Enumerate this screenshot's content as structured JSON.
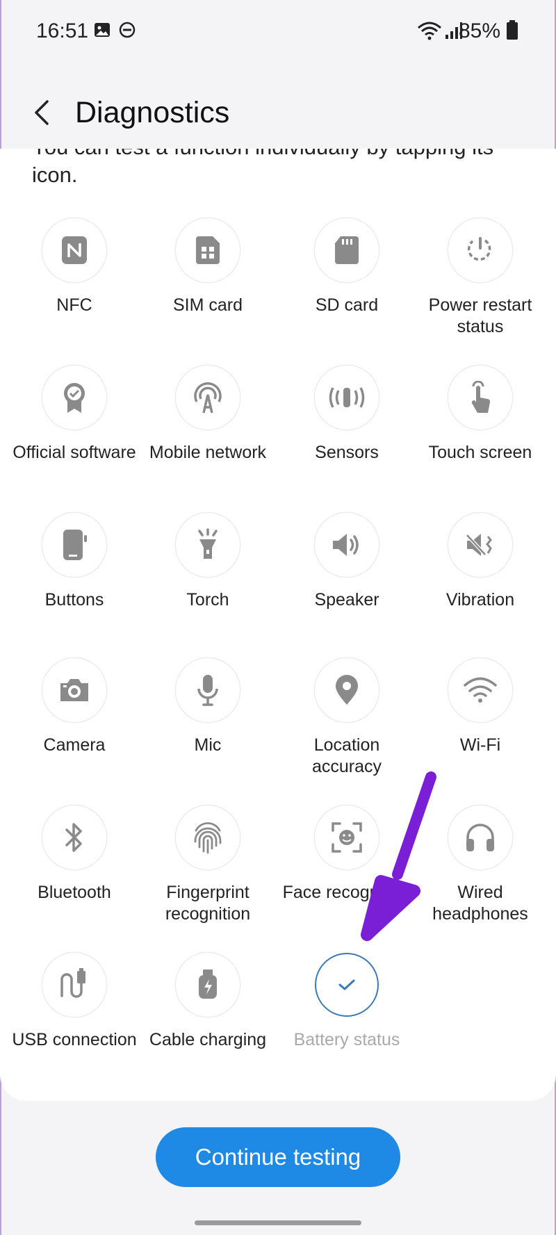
{
  "status_bar": {
    "time": "16:51",
    "battery_percent": "85%",
    "icons": [
      "image-icon",
      "do-not-disturb-icon",
      "wifi-icon",
      "signal-icon",
      "battery-icon"
    ]
  },
  "header": {
    "title": "Diagnostics",
    "back_icon": "chevron-left-icon"
  },
  "intro_text": "You can test a function individually by tapping its icon.",
  "tests": [
    {
      "label": "NFC",
      "icon": "nfc-icon",
      "status": "untested"
    },
    {
      "label": "SIM card",
      "icon": "sim-card-icon",
      "status": "untested"
    },
    {
      "label": "SD card",
      "icon": "sd-card-icon",
      "status": "untested"
    },
    {
      "label": "Power restart status",
      "icon": "power-restart-icon",
      "status": "untested"
    },
    {
      "label": "Official software",
      "icon": "official-software-icon",
      "status": "untested"
    },
    {
      "label": "Mobile network",
      "icon": "mobile-network-icon",
      "status": "untested"
    },
    {
      "label": "Sensors",
      "icon": "sensors-icon",
      "status": "untested"
    },
    {
      "label": "Touch screen",
      "icon": "touch-screen-icon",
      "status": "untested"
    },
    {
      "label": "Buttons",
      "icon": "buttons-icon",
      "status": "untested"
    },
    {
      "label": "Torch",
      "icon": "torch-icon",
      "status": "untested"
    },
    {
      "label": "Speaker",
      "icon": "speaker-icon",
      "status": "untested"
    },
    {
      "label": "Vibration",
      "icon": "vibration-icon",
      "status": "untested"
    },
    {
      "label": "Camera",
      "icon": "camera-icon",
      "status": "untested"
    },
    {
      "label": "Mic",
      "icon": "mic-icon",
      "status": "untested"
    },
    {
      "label": "Location accuracy",
      "icon": "location-icon",
      "status": "untested"
    },
    {
      "label": "Wi-Fi",
      "icon": "wifi-icon",
      "status": "untested"
    },
    {
      "label": "Bluetooth",
      "icon": "bluetooth-icon",
      "status": "untested"
    },
    {
      "label": "Fingerprint recognition",
      "icon": "fingerprint-icon",
      "status": "untested"
    },
    {
      "label": "Face recognition",
      "icon": "face-recognition-icon",
      "status": "untested"
    },
    {
      "label": "Wired headphones",
      "icon": "headphones-icon",
      "status": "untested"
    },
    {
      "label": "USB connection",
      "icon": "usb-icon",
      "status": "untested"
    },
    {
      "label": "Cable charging",
      "icon": "cable-charging-icon",
      "status": "untested"
    },
    {
      "label": "Battery status",
      "icon": "check-icon",
      "status": "done"
    }
  ],
  "continue_button": {
    "label": "Continue testing"
  },
  "colors": {
    "accent": "#1f8ae6",
    "icon_gray": "#8a8a8a",
    "done_ring": "#3a79b5",
    "annotation_arrow": "#7a1fd6"
  }
}
